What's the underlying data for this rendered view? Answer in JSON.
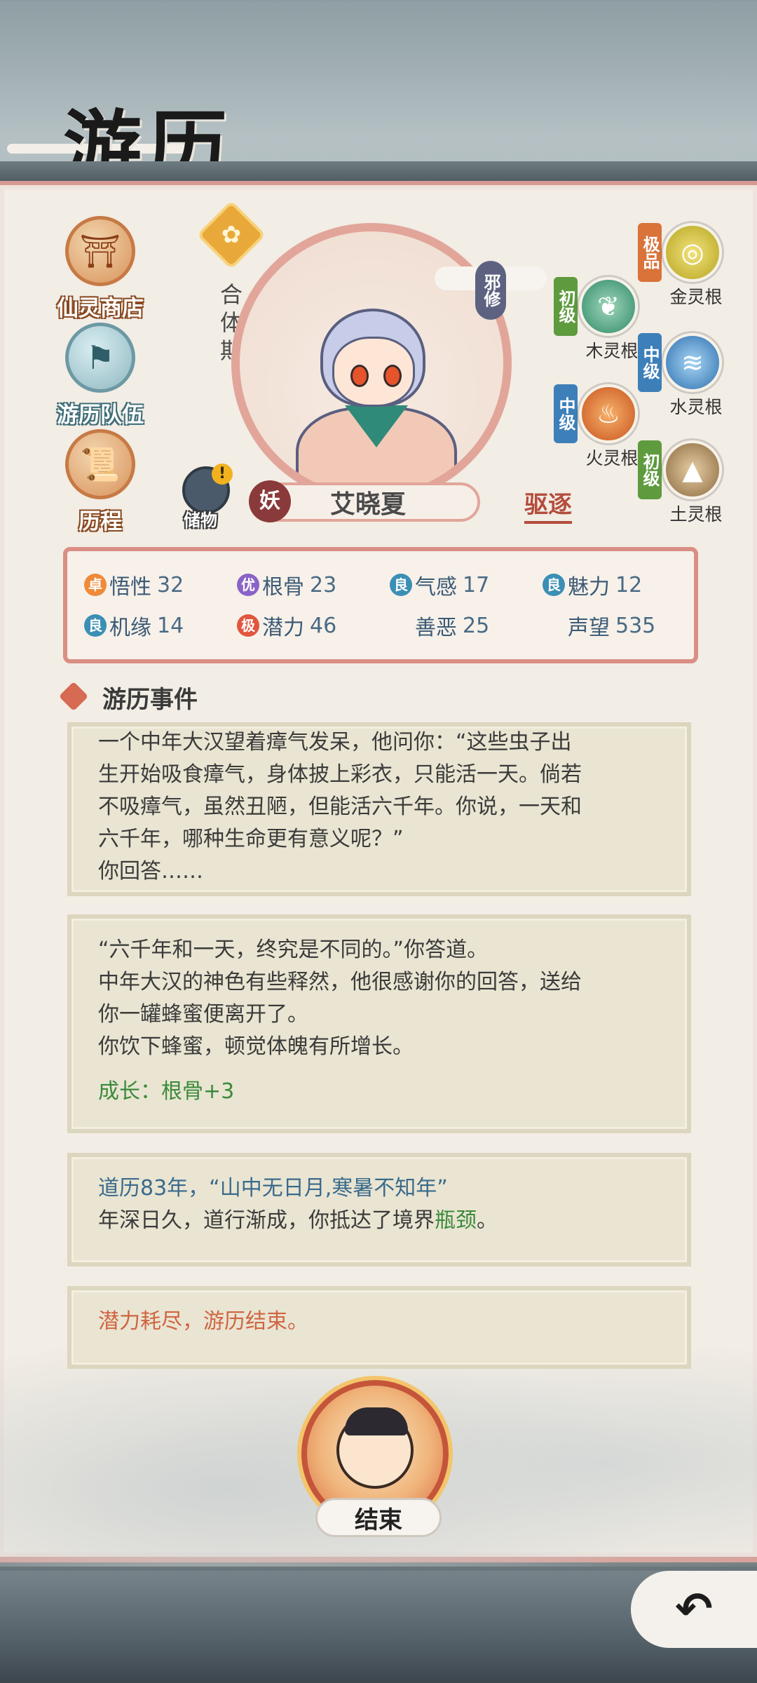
{
  "header": {
    "title": "游历"
  },
  "menu": {
    "shop": "仙灵商店",
    "team": "游历队伍",
    "journey": "历程"
  },
  "character": {
    "realm": "合体期",
    "tag": "邪修",
    "race": "妖",
    "name": "艾晓夏",
    "storage_label": "储物",
    "drive_label": "驱逐"
  },
  "roots": [
    {
      "grade": "极品",
      "name": "金灵根",
      "color": "#d9a33a"
    },
    {
      "grade": "初级",
      "name": "木灵根",
      "color": "#5e9a3e"
    },
    {
      "grade": "中级",
      "name": "水灵根",
      "color": "#3d7fb8"
    },
    {
      "grade": "中级",
      "name": "火灵根",
      "color": "#3d7fb8"
    },
    {
      "grade": "初级",
      "name": "土灵根",
      "color": "#5e9a3e"
    }
  ],
  "stats": [
    {
      "badge": "卓",
      "badge_color": "#ef8a3a",
      "label": "悟性",
      "value": "32"
    },
    {
      "badge": "优",
      "badge_color": "#8a63c7",
      "label": "根骨",
      "value": "23"
    },
    {
      "badge": "良",
      "badge_color": "#3b8fb5",
      "label": "气感",
      "value": "17"
    },
    {
      "badge": "良",
      "badge_color": "#3b8fb5",
      "label": "魅力",
      "value": "12"
    },
    {
      "badge": "良",
      "badge_color": "#3b8fb5",
      "label": "机缘",
      "value": "14"
    },
    {
      "badge": "极",
      "badge_color": "#e0563e",
      "label": "潜力",
      "value": "46"
    },
    {
      "badge": "",
      "badge_color": "",
      "label": "善恶",
      "value": "25"
    },
    {
      "badge": "",
      "badge_color": "",
      "label": "声望",
      "value": "535"
    }
  ],
  "events_title": "游历事件",
  "events": {
    "card1": [
      "一个中年大汉望着瘴气发呆，他问你：“这些虫子出",
      "生开始吸食瘴气，身体披上彩衣，只能活一天。倘若",
      "不吸瘴气，虽然丑陋，但能活六千年。你说，一天和",
      "六千年，哪种生命更有意义呢？”",
      "你回答……"
    ],
    "card2": [
      "“六千年和一天，终究是不同的。”你答道。",
      "中年大汉的神色有些释然，他很感谢你的回答，送给",
      "你一罐蜂蜜便离开了。",
      "你饮下蜂蜜，顿觉体魄有所增长。"
    ],
    "card2_growth_label": "成长：根骨+3",
    "card3_line1": "道历83年，“山中无日月,寒暑不知年”",
    "card3_line2_prefix": "年深日久，道行渐成，你抵达了境界",
    "card3_line2_highlight": "瓶颈",
    "card3_line2_suffix": "。",
    "card4": "潜力耗尽，游历结束。"
  },
  "end_button": "结束"
}
